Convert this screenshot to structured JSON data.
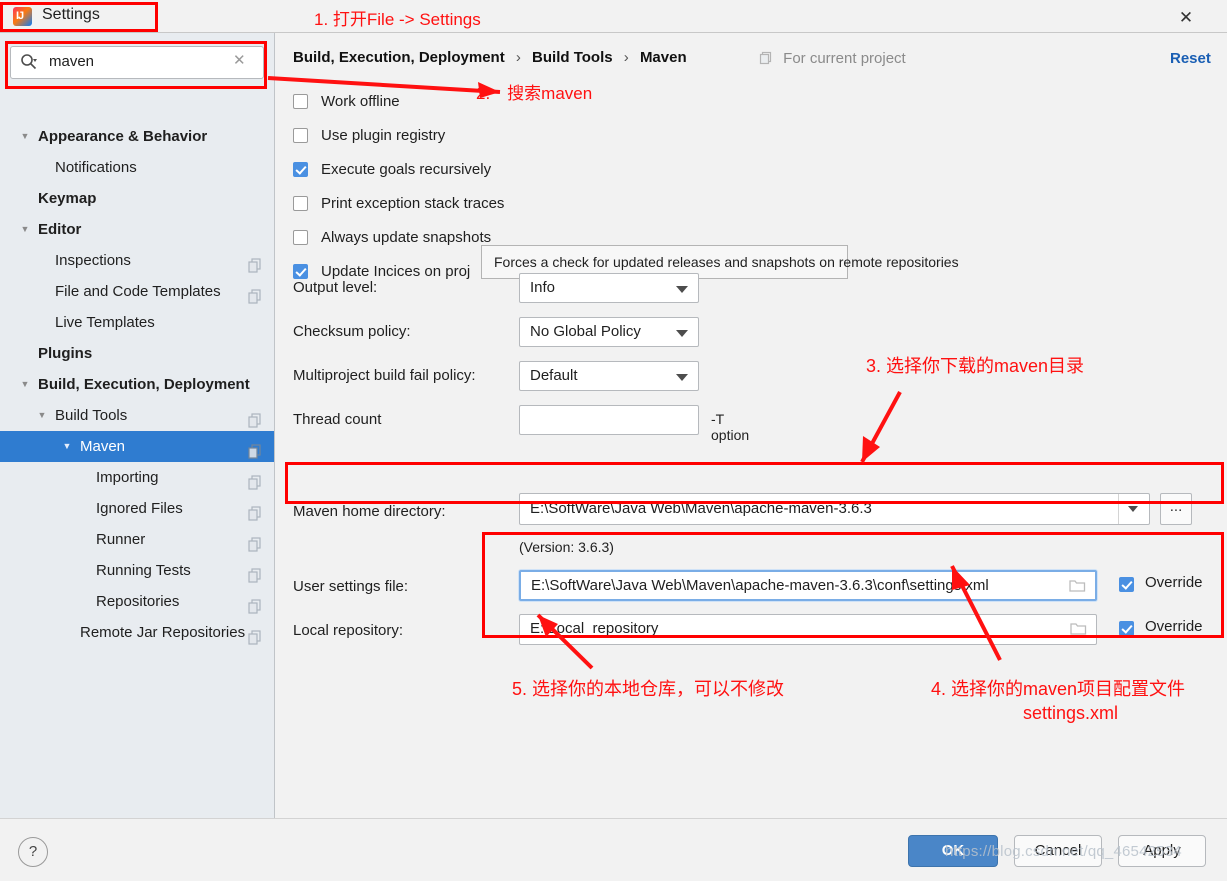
{
  "window": {
    "title": "Settings",
    "app_icon": "intellij-idea-icon",
    "close_icon": "close-icon"
  },
  "sidebar": {
    "search": {
      "value": "maven",
      "placeholder": "Search settings",
      "icon": "search-icon",
      "clear_icon": "clear-icon"
    },
    "items": [
      {
        "label": "Appearance & Behavior",
        "indent": 1,
        "bold": true,
        "twisty": "down",
        "copy_icon": false,
        "selected": false
      },
      {
        "label": "Notifications",
        "indent": 2,
        "bold": false,
        "twisty": "",
        "copy_icon": false,
        "selected": false
      },
      {
        "label": "Keymap",
        "indent": 1,
        "bold": true,
        "twisty": "",
        "copy_icon": false,
        "selected": false
      },
      {
        "label": "Editor",
        "indent": 1,
        "bold": true,
        "twisty": "down",
        "copy_icon": false,
        "selected": false
      },
      {
        "label": "Inspections",
        "indent": 2,
        "bold": false,
        "twisty": "",
        "copy_icon": true,
        "selected": false
      },
      {
        "label": "File and Code Templates",
        "indent": 2,
        "bold": false,
        "twisty": "",
        "copy_icon": true,
        "selected": false
      },
      {
        "label": "Live Templates",
        "indent": 2,
        "bold": false,
        "twisty": "",
        "copy_icon": false,
        "selected": false
      },
      {
        "label": "Plugins",
        "indent": 1,
        "bold": true,
        "twisty": "",
        "copy_icon": false,
        "selected": false
      },
      {
        "label": "Build, Execution, Deployment",
        "indent": 1,
        "bold": true,
        "twisty": "down",
        "copy_icon": false,
        "selected": false
      },
      {
        "label": "Build Tools",
        "indent": 2,
        "bold": false,
        "twisty": "down",
        "copy_icon": true,
        "selected": false
      },
      {
        "label": "Maven",
        "indent": 3,
        "bold": false,
        "twisty": "down",
        "copy_icon": true,
        "selected": true
      },
      {
        "label": "Importing",
        "indent": 4,
        "bold": false,
        "twisty": "",
        "copy_icon": true,
        "selected": false
      },
      {
        "label": "Ignored Files",
        "indent": 4,
        "bold": false,
        "twisty": "",
        "copy_icon": true,
        "selected": false
      },
      {
        "label": "Runner",
        "indent": 4,
        "bold": false,
        "twisty": "",
        "copy_icon": true,
        "selected": false
      },
      {
        "label": "Running Tests",
        "indent": 4,
        "bold": false,
        "twisty": "",
        "copy_icon": true,
        "selected": false
      },
      {
        "label": "Repositories",
        "indent": 4,
        "bold": false,
        "twisty": "",
        "copy_icon": true,
        "selected": false
      },
      {
        "label": "Remote Jar Repositories",
        "indent": 3,
        "bold": false,
        "twisty": "",
        "copy_icon": true,
        "selected": false
      }
    ]
  },
  "content": {
    "breadcrumb": {
      "part1": "Build, Execution, Deployment",
      "part2": "Build Tools",
      "part3": "Maven",
      "separator": "›"
    },
    "scope": {
      "label": "For current project",
      "icon": "project-scope-icon"
    },
    "reset_label": "Reset",
    "checkboxes": [
      {
        "label": "Work offline",
        "checked": false
      },
      {
        "label": "Use plugin registry",
        "checked": false
      },
      {
        "label": "Execute goals recursively",
        "checked": true
      },
      {
        "label": "Print exception stack traces",
        "checked": false
      },
      {
        "label": "Always update snapshots",
        "checked": false
      },
      {
        "label": "Update Incices on proj",
        "checked": true
      }
    ],
    "tooltip": "Forces a check for updated releases and snapshots on remote repositories",
    "form_rows": [
      {
        "label": "Output level:",
        "type": "combo",
        "value": "Info",
        "suffix": ""
      },
      {
        "label": "Checksum policy:",
        "type": "combo",
        "value": "No Global Policy",
        "suffix": ""
      },
      {
        "label": "Multiproject build fail policy:",
        "type": "combo",
        "value": "Default",
        "suffix": ""
      },
      {
        "label": "Thread count",
        "type": "text",
        "value": "",
        "suffix": "-T option"
      }
    ],
    "maven_home": {
      "label": "Maven home directory:",
      "value": "E:\\SoftWare\\Java Web\\Maven\\apache-maven-3.6.3",
      "browse_label": "...",
      "version_text": "(Version: 3.6.3)"
    },
    "user_settings": {
      "label": "User settings file:",
      "value": "E:\\SoftWare\\Java Web\\Maven\\apache-maven-3.6.3\\conf\\settings.xml",
      "override_label": "Override",
      "override_checked": true,
      "folder_icon": "folder-icon"
    },
    "local_repository": {
      "label": "Local repository:",
      "value": "E:\\Local_repository",
      "override_label": "Override",
      "override_checked": true,
      "folder_icon": "folder-icon"
    }
  },
  "footer": {
    "help_label": "?",
    "ok_label": "OK",
    "cancel_label": "Cancel",
    "apply_label": "Apply"
  },
  "annotations": [
    {
      "id": "a1",
      "text": "1. 打开File -> Settings"
    },
    {
      "id": "a2",
      "text": "2.　搜索maven"
    },
    {
      "id": "a3",
      "text": "3. 选择你下载的maven目录"
    },
    {
      "id": "a4a",
      "text": "4. 选择你的maven项目配置文件"
    },
    {
      "id": "a4b",
      "text": "settings.xml"
    },
    {
      "id": "a5",
      "text": "5. 选择你的本地仓库，可以不修改"
    }
  ],
  "watermark": "https://blog.csdn.net/qq_46542534",
  "colors": {
    "accent": "#2f7cd0",
    "annotation": "#ff1111",
    "checkbox_on": "#4a90e2",
    "link": "#1a5fb4",
    "ok_button": "#4a86c8"
  }
}
